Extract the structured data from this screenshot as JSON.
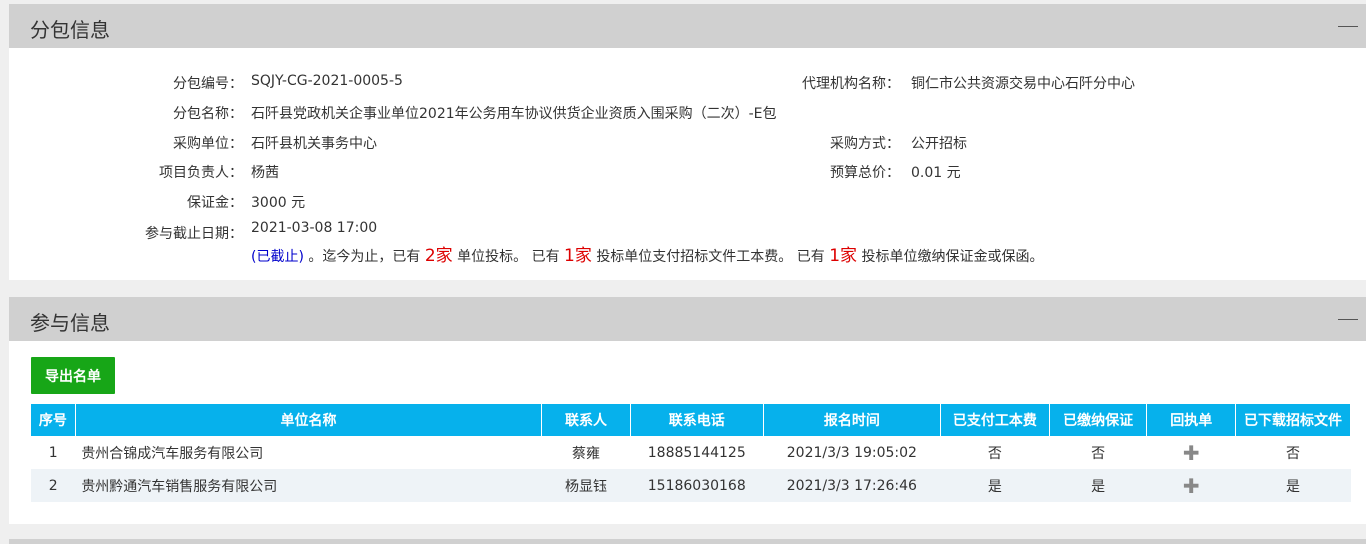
{
  "package_section": {
    "title": "分包信息",
    "fields": {
      "package_no_label": "分包编号：",
      "package_no": "SQJY-CG-2021-0005-5",
      "agency_label": "代理机构名称：",
      "agency": "铜仁市公共资源交易中心石阡分中心",
      "package_name_label": "分包名称：",
      "package_name": "石阡县党政机关企事业单位2021年公务用车协议供货企业资质入围采购（二次）-E包",
      "buyer_label": "采购单位：",
      "buyer": "石阡县机关事务中心",
      "method_label": "采购方式：",
      "method": "公开招标",
      "manager_label": "项目负责人：",
      "manager": "杨茜",
      "budget_label": "预算总价：",
      "budget": "0.01 元",
      "deposit_label": "保证金：",
      "deposit": "3000 元",
      "deadline_label": "参与截止日期：",
      "deadline": "2021-03-08 17:00"
    },
    "status": {
      "closed": "(已截止)",
      "text1": "。迄今为止，已有",
      "count1": "2家",
      "text2": "单位投标。 已有",
      "count2": "1家",
      "text3": "投标单位支付招标文件工本费。 已有",
      "count3": "1家",
      "text4": "投标单位缴纳保证金或保函。"
    }
  },
  "participation_section": {
    "title": "参与信息",
    "export_button": "导出名单",
    "columns": [
      "序号",
      "单位名称",
      "联系人",
      "联系电话",
      "报名时间",
      "已支付工本费",
      "已缴纳保证",
      "回执单",
      "已下载招标文件"
    ],
    "rows": [
      {
        "no": "1",
        "company": "贵州合锦成汽车服务有限公司",
        "contact": "蔡雍",
        "phone": "18885144125",
        "time": "2021/3/3 19:05:02",
        "paid": "否",
        "deposit": "否",
        "receipt": "✚",
        "downloaded": "否"
      },
      {
        "no": "2",
        "company": "贵州黔通汽车销售服务有限公司",
        "contact": "杨显钰",
        "phone": "15186030168",
        "time": "2021/3/3 17:26:46",
        "paid": "是",
        "deposit": "是",
        "receipt": "✚",
        "downloaded": "是"
      }
    ]
  },
  "colors": {
    "header_bg": "#06b1ec",
    "export_bg": "#17a617",
    "highlight": "#dd0000"
  }
}
